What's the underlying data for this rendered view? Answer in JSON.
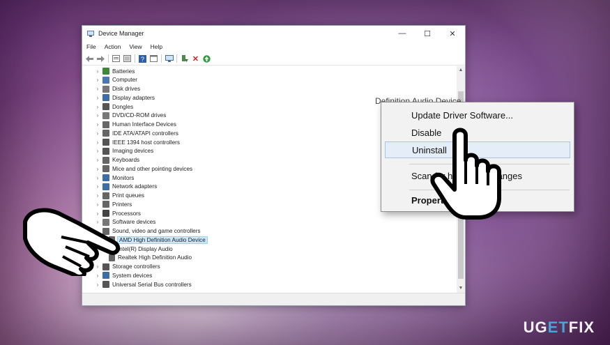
{
  "window": {
    "title": "Device Manager",
    "controls": {
      "minimize": "—",
      "maximize": "☐",
      "close": "✕"
    }
  },
  "menubar": [
    "File",
    "Action",
    "View",
    "Help"
  ],
  "toolbar_icons": [
    "back-icon",
    "forward-icon",
    "properties-icon",
    "update-driver-icon",
    "help-icon",
    "view-icon",
    "monitor-icon",
    "enable-device-icon",
    "uninstall-icon",
    "scan-icon"
  ],
  "tree": {
    "categories": [
      {
        "label": "Batteries",
        "icon": "battery-icon",
        "color": "#3a8a3a"
      },
      {
        "label": "Computer",
        "icon": "computer-icon",
        "color": "#4a78b5"
      },
      {
        "label": "Disk drives",
        "icon": "disk-icon",
        "color": "#777777"
      },
      {
        "label": "Display adapters",
        "icon": "display-adapter-icon",
        "color": "#3d6ea8"
      },
      {
        "label": "Dongles",
        "icon": "dongle-icon",
        "color": "#555555"
      },
      {
        "label": "DVD/CD-ROM drives",
        "icon": "dvd-icon",
        "color": "#777777"
      },
      {
        "label": "Human Interface Devices",
        "icon": "hid-icon",
        "color": "#666666"
      },
      {
        "label": "IDE ATA/ATAPI controllers",
        "icon": "ide-icon",
        "color": "#666666"
      },
      {
        "label": "IEEE 1394 host controllers",
        "icon": "ieee1394-icon",
        "color": "#555555"
      },
      {
        "label": "Imaging devices",
        "icon": "camera-icon",
        "color": "#555555"
      },
      {
        "label": "Keyboards",
        "icon": "keyboard-icon",
        "color": "#666666"
      },
      {
        "label": "Mice and other pointing devices",
        "icon": "mouse-icon",
        "color": "#666666"
      },
      {
        "label": "Monitors",
        "icon": "monitor-icon",
        "color": "#3d6ea8"
      },
      {
        "label": "Network adapters",
        "icon": "network-icon",
        "color": "#3d6ea8"
      },
      {
        "label": "Print queues",
        "icon": "printer-icon",
        "color": "#666666"
      },
      {
        "label": "Printers",
        "icon": "printer-icon",
        "color": "#666666"
      },
      {
        "label": "Processors",
        "icon": "processor-icon",
        "color": "#444444"
      },
      {
        "label": "Software devices",
        "icon": "software-icon",
        "color": "#777777"
      },
      {
        "label": "Sound, video and game controllers",
        "icon": "speaker-icon",
        "color": "#666666",
        "expanded": true
      },
      {
        "label": "AMD High Definition Audio Device",
        "icon": "speaker-icon",
        "color": "#666666",
        "child": true,
        "selected": true
      },
      {
        "label": "Intel(R) Display Audio",
        "icon": "speaker-icon",
        "color": "#666666",
        "child": true
      },
      {
        "label": "Realtek High Definition Audio",
        "icon": "speaker-icon",
        "color": "#666666",
        "child": true
      },
      {
        "label": "Storage controllers",
        "icon": "storage-icon",
        "color": "#555555"
      },
      {
        "label": "System devices",
        "icon": "system-icon",
        "color": "#3d6ea8"
      },
      {
        "label": "Universal Serial Bus controllers",
        "icon": "usb-icon",
        "color": "#555555"
      }
    ]
  },
  "context_menu": {
    "behind_text": "Definition Audio Device",
    "items": [
      {
        "label": "Update Driver Software..."
      },
      {
        "label": "Disable"
      },
      {
        "label": "Uninstall",
        "hover": true
      },
      {
        "label": "Scan for hardware changes"
      },
      {
        "label": "Properties",
        "bold": true
      }
    ]
  },
  "watermark": {
    "part1": "UG",
    "accent": "ET",
    "part2": "FIX"
  },
  "colors": {
    "selection": "#cce8ff",
    "accent": "#4aa3d8"
  }
}
